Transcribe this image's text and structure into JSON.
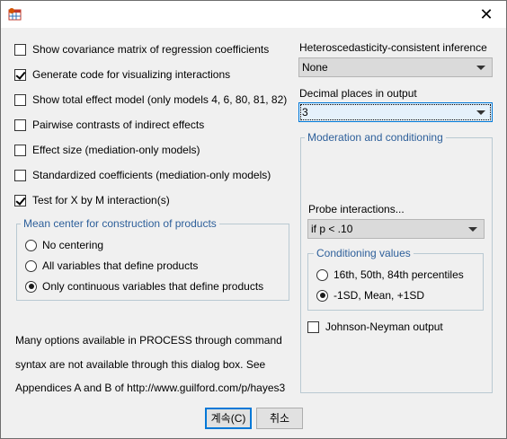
{
  "window": {
    "close_glyph": "✕"
  },
  "options": {
    "show_covariance": {
      "label": "Show covariance matrix of regression coefficients",
      "checked": false
    },
    "generate_code": {
      "label": "Generate code for visualizing interactions",
      "checked": true
    },
    "total_effect": {
      "label": "Show total effect model (only models 4, 6, 80, 81, 82)",
      "checked": false
    },
    "pairwise_contrasts": {
      "label": "Pairwise contrasts of indirect effects",
      "checked": false
    },
    "effect_size": {
      "label": "Effect size (mediation-only models)",
      "checked": false
    },
    "standardized": {
      "label": "Standardized coefficients (mediation-only models)",
      "checked": false
    },
    "test_xm": {
      "label": "Test for X by M interaction(s)",
      "checked": true
    }
  },
  "mean_center": {
    "title": "Mean center for construction of products",
    "options": [
      {
        "label": "No centering",
        "selected": false
      },
      {
        "label": "All variables that define products",
        "selected": false
      },
      {
        "label": "Only continuous variables that define products",
        "selected": true
      }
    ]
  },
  "hc_inference": {
    "label": "Heteroscedasticity-consistent inference",
    "value": "None"
  },
  "decimal_places": {
    "label": "Decimal places in output",
    "value": "3"
  },
  "moderation": {
    "title": "Moderation and conditioning",
    "probe_label": "Probe interactions...",
    "probe_value": "if p < .10",
    "conditioning": {
      "title": "Conditioning values",
      "options": [
        {
          "label": "16th, 50th, 84th percentiles",
          "selected": false
        },
        {
          "label": "-1SD, Mean, +1SD",
          "selected": true
        }
      ]
    },
    "johnson_neyman": {
      "label": "Johnson-Neyman output",
      "checked": false
    }
  },
  "note": {
    "line1": "Many options available in PROCESS through command",
    "line2": "syntax are not available through this dialog box.  See",
    "line3": "Appendices A and B of http://www.guilford.com/p/hayes3"
  },
  "buttons": {
    "continue": "계속(C)",
    "cancel": "취소"
  },
  "colors": {
    "group_label": "#2d5f9a",
    "focus_border": "#0078d7"
  }
}
